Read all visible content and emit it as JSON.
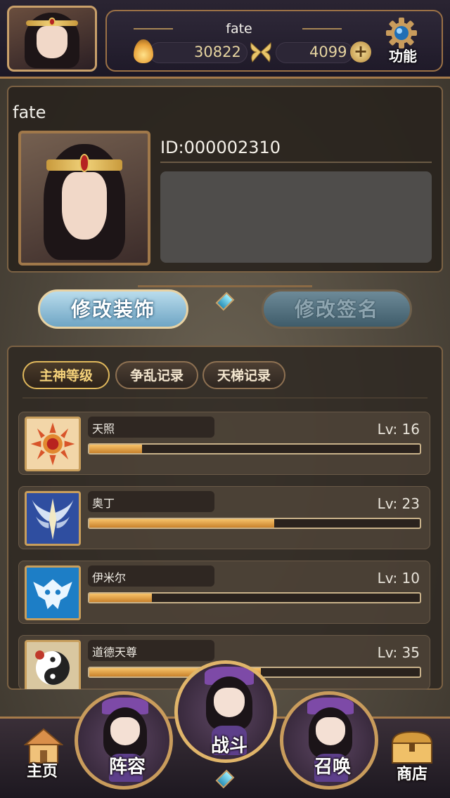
{
  "header": {
    "player_name": "fate",
    "gold": "30822",
    "gems": "4099",
    "func_label": "功能",
    "icons": [
      "flame-icon",
      "butterfly-icon",
      "plus-icon",
      "gear-icon"
    ]
  },
  "profile": {
    "name": "fate",
    "id_text": "ID:000002310",
    "signature": ""
  },
  "actions": {
    "edit_decoration": "修改装饰",
    "edit_signature": "修改签名"
  },
  "tabs": [
    {
      "label": "主神等级",
      "active": true
    },
    {
      "label": "争乱记录",
      "active": false
    },
    {
      "label": "天梯记录",
      "active": false
    }
  ],
  "gods": [
    {
      "name": "天照",
      "level": "Lv: 16",
      "progress": 0.16,
      "icon": "sun-icon",
      "color": "#f2d6a8"
    },
    {
      "name": "奥丁",
      "level": "Lv: 23",
      "progress": 0.56,
      "icon": "winged-spear-icon",
      "color": "#2f4ea0"
    },
    {
      "name": "伊米尔",
      "level": "Lv: 10",
      "progress": 0.19,
      "icon": "frost-skull-icon",
      "color": "#1d7ec6"
    },
    {
      "name": "道德天尊",
      "level": "Lv: 35",
      "progress": 0.52,
      "icon": "yin-yang-icon",
      "color": "#d9c7a0"
    }
  ],
  "nav": {
    "home": "主页",
    "lineup": "阵容",
    "battle": "战斗",
    "summon": "召唤",
    "shop": "商店"
  },
  "colors": {
    "accent_gold": "#c99c5c",
    "xp_fill": "#e9a13f",
    "button_blue": "#8cc0da"
  }
}
